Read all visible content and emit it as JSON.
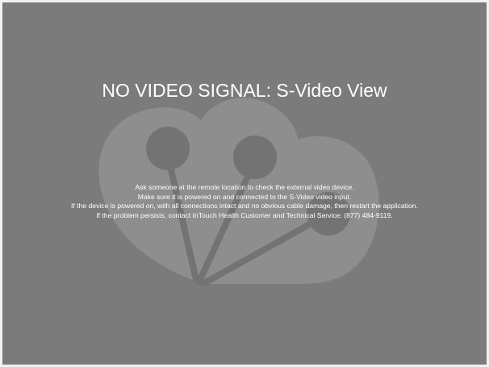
{
  "window": {
    "background_color": "#7b7b7b",
    "logo_color": "#8e8e8e",
    "logo_dark_color": "#737373"
  },
  "video": {
    "title": "NO VIDEO SIGNAL: S-Video View",
    "message_lines": [
      "Ask someone at the remote location to check the external video device.",
      "Make sure it is powered on and connected to the S-Video video input.",
      "If the device is powered on, with all connections intact and no obvious cable damage, then restart the application.",
      "If the problem persists, contact InTouch Health Customer and Technical Service: (877) 484-9119."
    ]
  },
  "icons": {
    "watermark": "intouch-health-logo-icon"
  }
}
